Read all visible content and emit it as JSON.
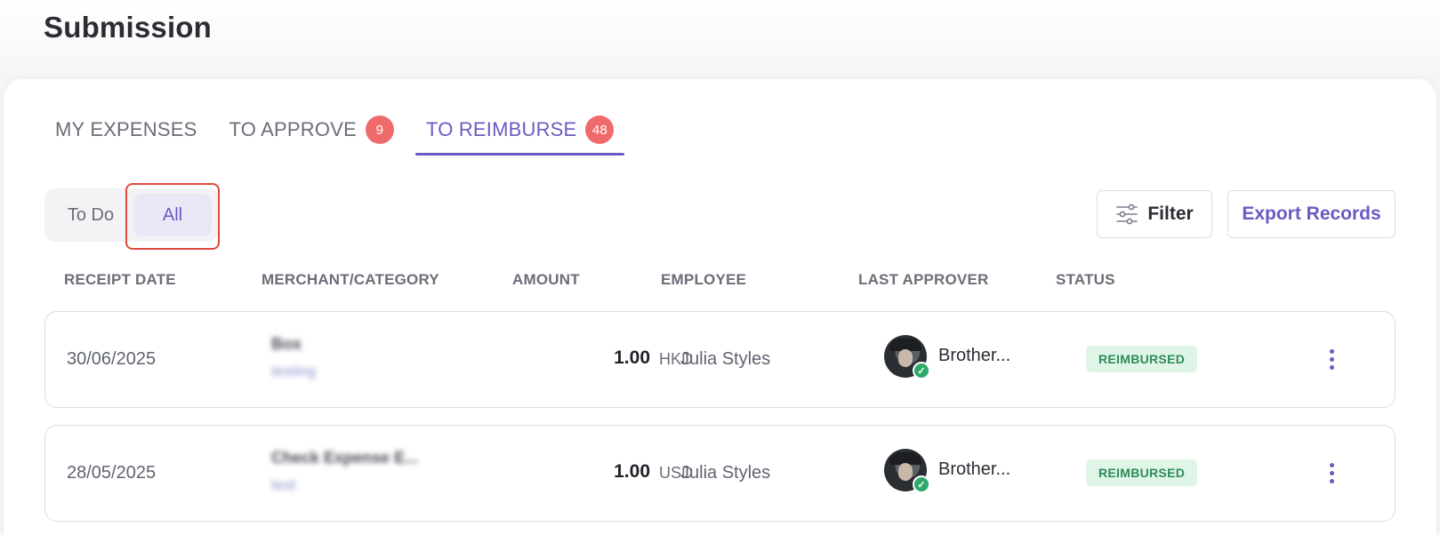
{
  "page": {
    "title": "Submission"
  },
  "tabs": [
    {
      "label": "MY EXPENSES",
      "badge": null,
      "active": false
    },
    {
      "label": "TO APPROVE",
      "badge": "9",
      "active": false
    },
    {
      "label": "TO REIMBURSE",
      "badge": "48",
      "active": true
    }
  ],
  "segment": {
    "todo_label": "To Do",
    "all_label": "All",
    "selected": "All"
  },
  "toolbar": {
    "filter_label": "Filter",
    "filter_icon": "sliders-icon",
    "export_label": "Export Records"
  },
  "table": {
    "headers": [
      "RECEIPT DATE",
      "MERCHANT/CATEGORY",
      "AMOUNT",
      "EMPLOYEE",
      "LAST APPROVER",
      "STATUS"
    ],
    "rows": [
      {
        "date": "30/06/2025",
        "merchant": "Box",
        "category": "testing",
        "amount": "1.00",
        "currency": "HKD",
        "employee": "Julia Styles",
        "approver": "Brother...",
        "status": "REIMBURSED"
      },
      {
        "date": "28/05/2025",
        "merchant": "Check Expense E...",
        "category": "test",
        "amount": "1.00",
        "currency": "USD",
        "employee": "Julia Styles",
        "approver": "Brother...",
        "status": "REIMBURSED"
      }
    ]
  },
  "colors": {
    "accent": "#6a5bc2",
    "badge": "#ef6b6b",
    "status_bg": "#dff5e8",
    "status_text": "#2e8a58",
    "highlight": "#e0493d"
  }
}
